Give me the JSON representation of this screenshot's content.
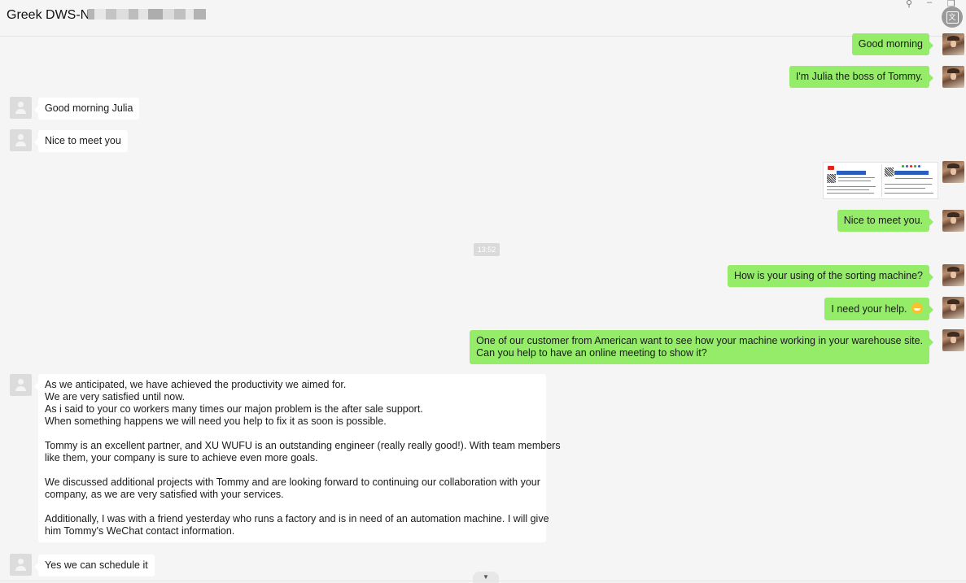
{
  "window": {
    "title": "Greek DWS-N",
    "pin_icon": "pin-icon",
    "minimize_icon": "minimize-icon",
    "restore_icon": "restore-icon",
    "translate_icon": "translate-icon"
  },
  "messages": [
    {
      "side": "out",
      "text": "Good morning"
    },
    {
      "side": "out",
      "text": "I'm Julia the boss of Tommy."
    },
    {
      "side": "in",
      "text": "Good morning Julia"
    },
    {
      "side": "in",
      "text": "Nice to meet you"
    },
    {
      "side": "out",
      "type": "image",
      "text": "business-card-image"
    },
    {
      "side": "out",
      "text": "Nice to meet you."
    },
    {
      "side": "time",
      "text": "13:52"
    },
    {
      "side": "out",
      "text": "How is your using of the sorting machine?"
    },
    {
      "side": "out",
      "text": "I need your help.",
      "emoji": "grin-emoji"
    },
    {
      "side": "out",
      "lines": [
        "One of our customer from American want to see how your machine working in your warehouse site.",
        "Can you help to have an online meeting to show it?"
      ]
    },
    {
      "side": "in",
      "paragraphs": [
        [
          "As we anticipated, we have achieved the productivity we aimed for.",
          "We are very satisfied until now.",
          "As i said to your co workers many times our majon problem is the after sale support.",
          "When something happens we will need you help to fix it as soon is possible."
        ],
        [
          "Tommy is an excellent partner, and XU WUFU is an outstanding engineer (really really good!). With team members",
          "like them, your company is sure to achieve even more goals."
        ],
        [
          "We discussed additional projects with Tommy and are looking forward to continuing our collaboration with your",
          "company, as we are very satisfied with your services."
        ],
        [
          "Additionally, I was with a friend yesterday who runs a factory and is in need of an automation machine. I will give",
          "him Tommy's WeChat contact information."
        ]
      ]
    },
    {
      "side": "in",
      "text": "Yes we can schedule it"
    }
  ],
  "colors": {
    "outgoing": "#95ec69",
    "incoming": "#ffffff",
    "background": "#f5f5f5"
  },
  "scroll_icon": "scroll-down-icon"
}
